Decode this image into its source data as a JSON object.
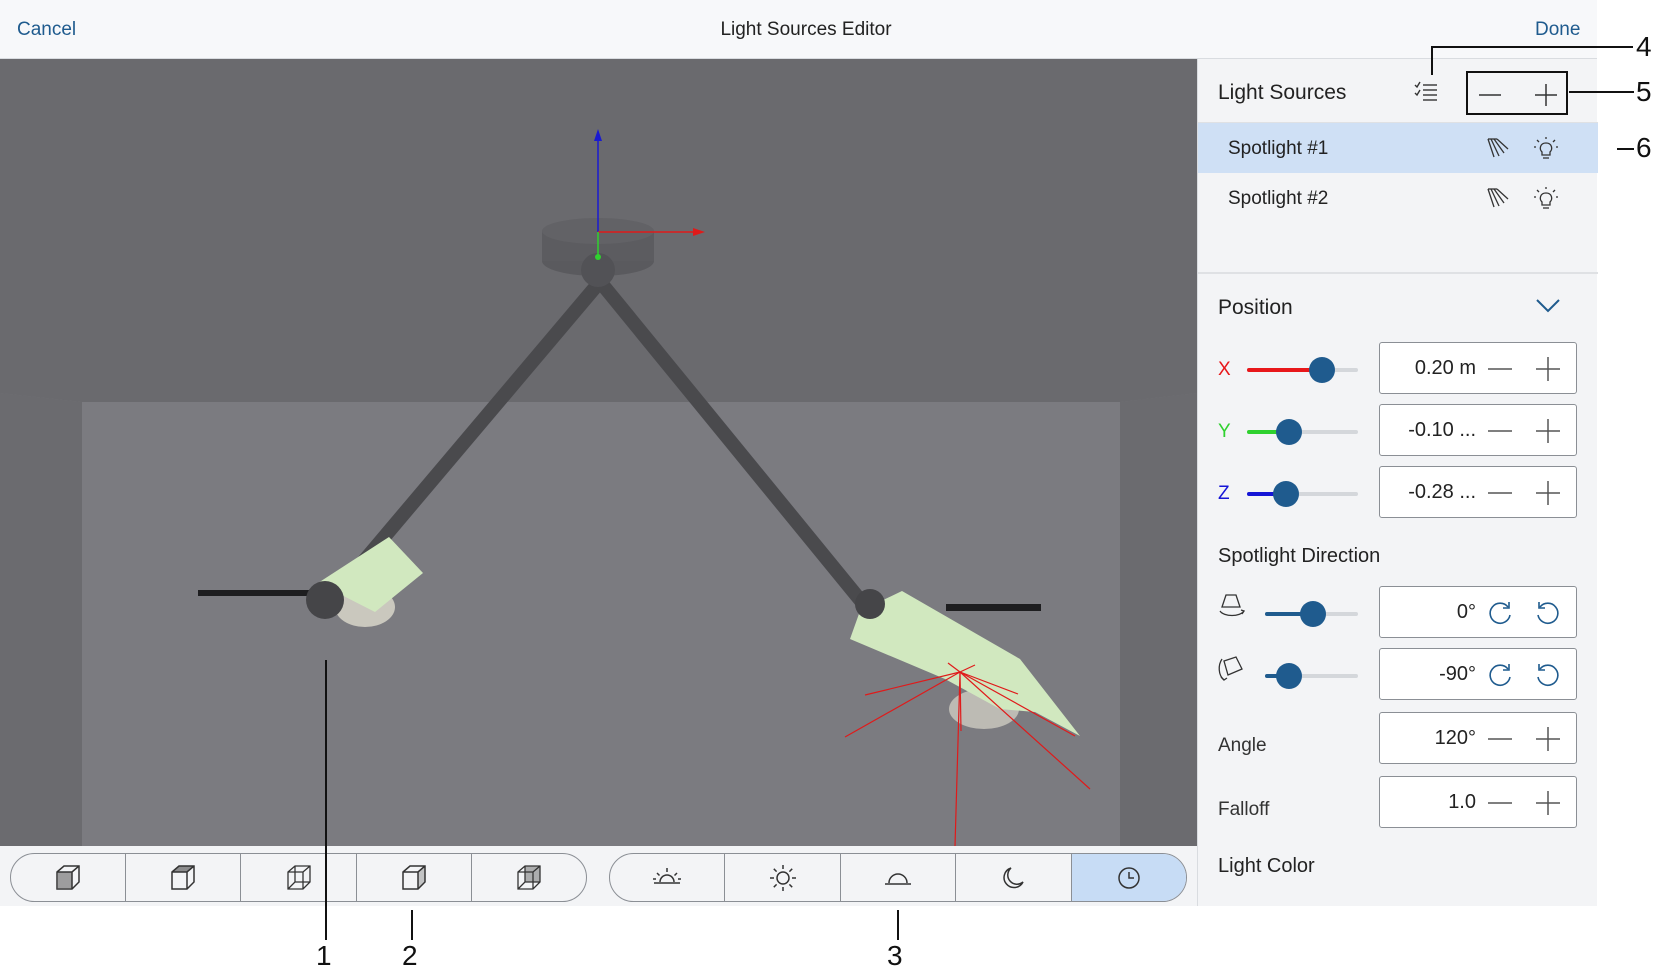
{
  "header": {
    "cancel_label": "Cancel",
    "title": "Light Sources Editor",
    "done_label": "Done"
  },
  "light_sources": {
    "title": "Light Sources",
    "items": [
      {
        "label": "Spotlight #1",
        "selected": true
      },
      {
        "label": "Spotlight #2",
        "selected": false
      }
    ]
  },
  "position": {
    "title": "Position",
    "axes": [
      {
        "label": "X",
        "color": "#e8171a",
        "value_text": "0.20 m",
        "slider": 0.68
      },
      {
        "label": "Y",
        "color": "#2fd12f",
        "value_text": "-0.10 ...",
        "slider": 0.38
      },
      {
        "label": "Z",
        "color": "#1515d6",
        "value_text": "-0.28 ...",
        "slider": 0.35
      }
    ]
  },
  "spotlight_direction": {
    "title": "Spotlight Direction",
    "rows": [
      {
        "icon": "spotlight-rotate-horizontal-icon",
        "value_text": "0°",
        "slider": 0.52
      },
      {
        "icon": "spotlight-rotate-vertical-icon",
        "value_text": "-90°",
        "slider": 0.26
      }
    ]
  },
  "angle": {
    "label": "Angle",
    "value_text": "120°"
  },
  "falloff": {
    "label": "Falloff",
    "value_text": "1.0"
  },
  "light_color": {
    "title": "Light Color"
  },
  "view_toolbar": {
    "buttons": [
      "cube-view-front-icon",
      "cube-view-top-icon",
      "cube-view-side-icon",
      "cube-view-right-icon",
      "cube-view-back-icon"
    ]
  },
  "lighting_toolbar": {
    "buttons": [
      "sunrise-icon",
      "sun-icon",
      "dome-light-icon",
      "moon-icon",
      "clock-icon"
    ],
    "active_index": 4
  },
  "callouts": [
    "1",
    "2",
    "3",
    "4",
    "5",
    "6"
  ],
  "colors": {
    "accent": "#1f5b8e",
    "selection": "#cfe0f5",
    "active_button": "#c7dcf5"
  }
}
